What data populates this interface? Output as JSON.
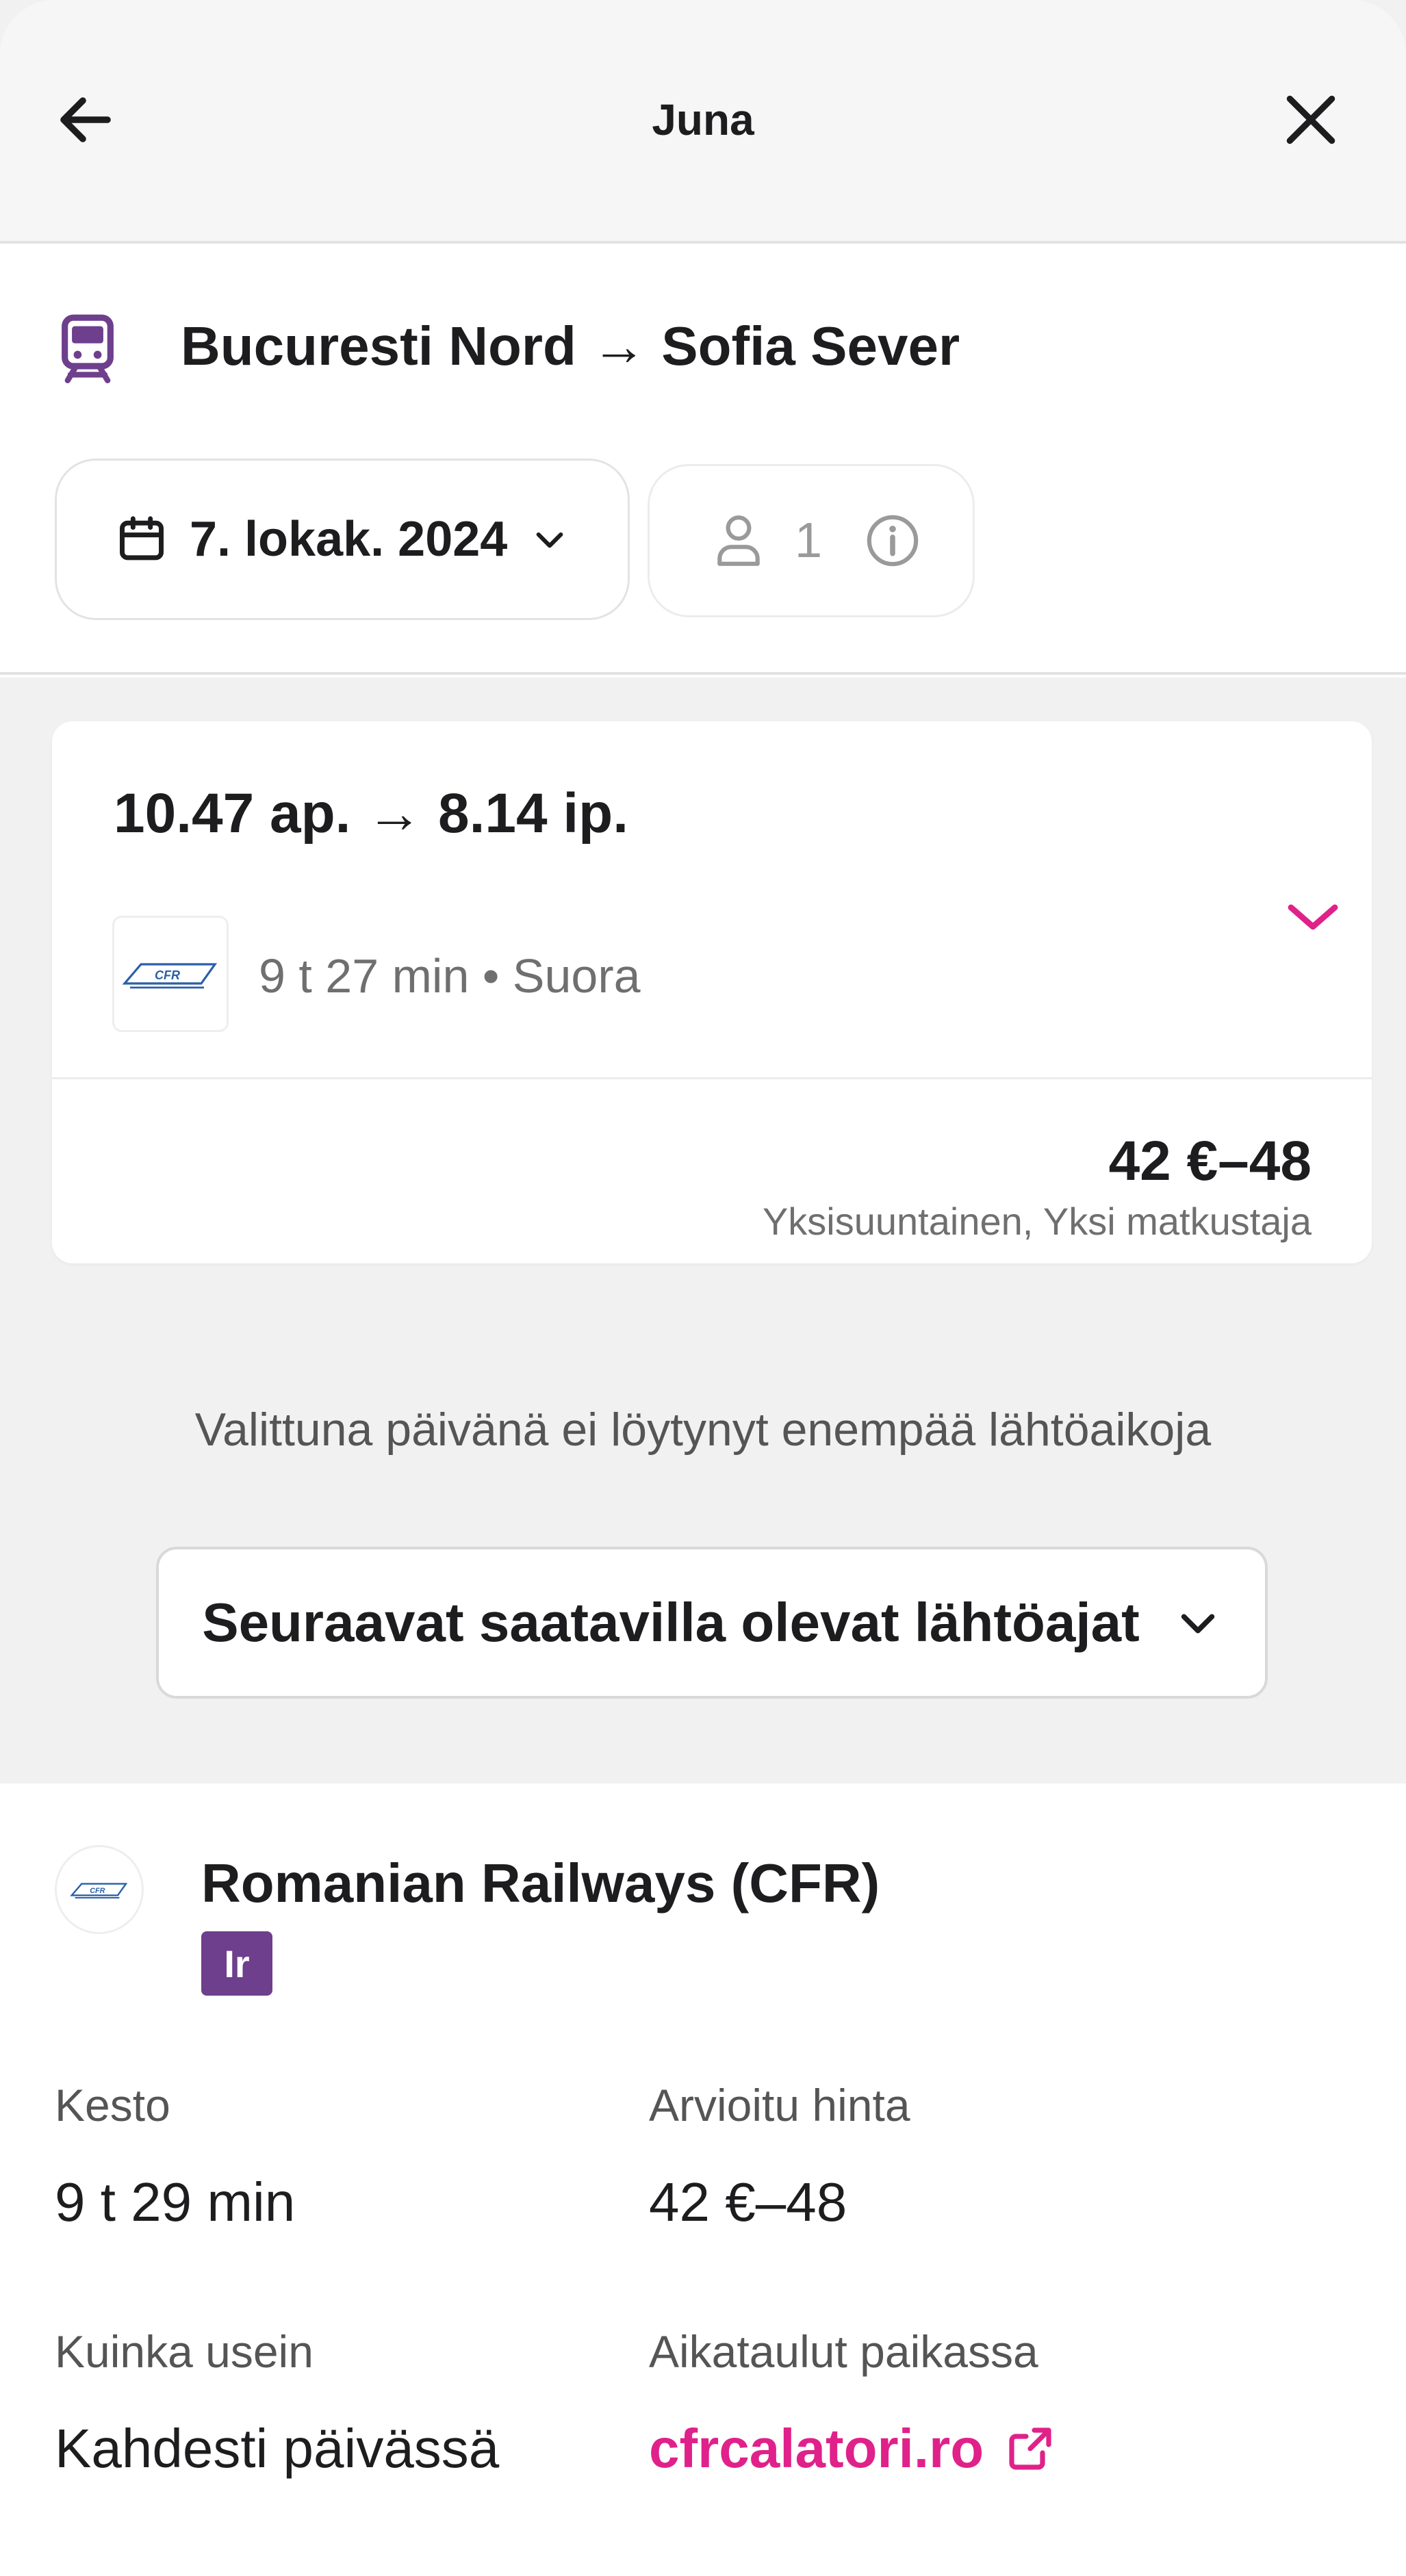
{
  "header": {
    "title": "Juna",
    "back_icon": "arrow-left-icon",
    "close_icon": "close-icon"
  },
  "route": {
    "icon": "train-icon",
    "title": "Bucuresti Nord → Sofia Sever",
    "date": "7. lokak. 2024",
    "passengers": "1"
  },
  "journey": {
    "times": "10.47 ap.  →  8.14 ip.",
    "meta": "9 t 27 min • Suora",
    "price": "42 €–48",
    "price_note": "Yksisuuntainen, Yksi matkustaja",
    "operator_logo": "CFR"
  },
  "results": {
    "no_more_text": "Valittuna päivänä ei löytynyt enempää lähtöaikoja",
    "next_button": "Seuraavat saatavilla olevat lähtöajat"
  },
  "operator": {
    "name": "Romanian Railways (CFR)",
    "badge": "Ir",
    "logo": "CFR",
    "duration_label": "Kesto",
    "duration_value": "9 t 29 min",
    "price_label": "Arvioitu hinta",
    "price_value": "42 €–48",
    "frequency_label": "Kuinka usein",
    "frequency_value": "Kahdesti päivässä",
    "schedules_label": "Aikataulut paikassa",
    "schedules_link": "cfrcalatori.ro"
  },
  "colors": {
    "accent": "#e0218a",
    "train_icon": "#6e3f8c",
    "badge": "#6e3f8c",
    "background": "#f1f1f1",
    "text": "#1d1d1f",
    "muted": "#6f6f6f"
  }
}
